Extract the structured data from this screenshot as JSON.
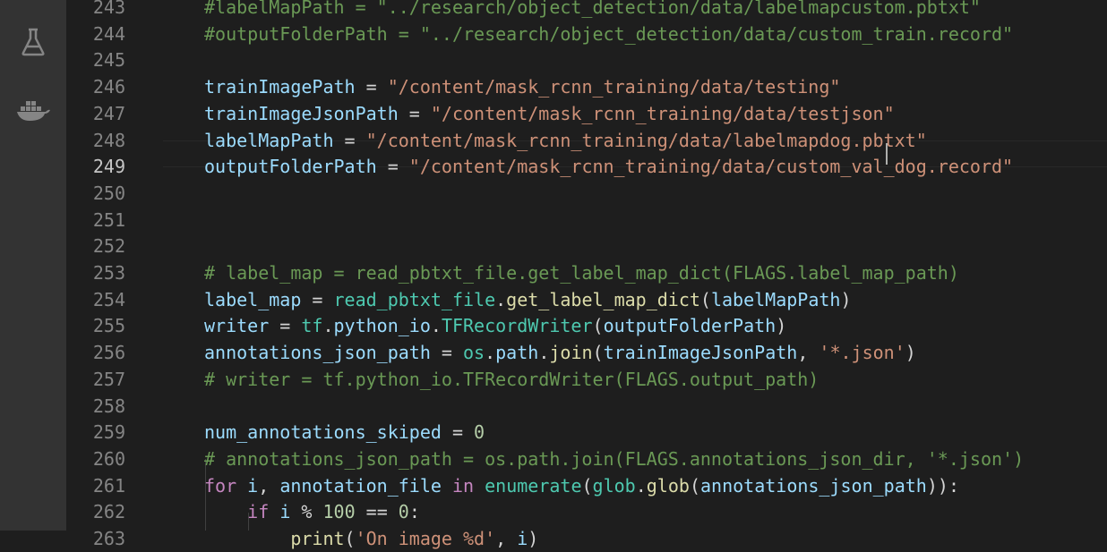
{
  "activity_bar": {
    "icons": [
      "flask-icon",
      "docker-icon"
    ]
  },
  "editor": {
    "current_line": "249",
    "lines": [
      {
        "num": "243",
        "tokens": [
          {
            "c": "c",
            "t": "#labelMapPath = \"../research/object_detection/data/labelmapcustom.pbtxt\""
          }
        ]
      },
      {
        "num": "244",
        "tokens": [
          {
            "c": "c",
            "t": "#outputFolderPath = \"../research/object_detection/data/custom_train.record\""
          }
        ]
      },
      {
        "num": "245",
        "tokens": []
      },
      {
        "num": "246",
        "tokens": [
          {
            "c": "v",
            "t": "trainImagePath"
          },
          {
            "c": "o",
            "t": " = "
          },
          {
            "c": "s",
            "t": "\"/content/mask_rcnn_training/data/testing\""
          }
        ]
      },
      {
        "num": "247",
        "tokens": [
          {
            "c": "v",
            "t": "trainImageJsonPath"
          },
          {
            "c": "o",
            "t": " = "
          },
          {
            "c": "s",
            "t": "\"/content/mask_rcnn_training/data/testjson\""
          }
        ]
      },
      {
        "num": "248",
        "tokens": [
          {
            "c": "v",
            "t": "labelMapPath"
          },
          {
            "c": "o",
            "t": " = "
          },
          {
            "c": "s",
            "t": "\"/content/mask_rcnn_training/data/labelmapdog.pbtxt\""
          }
        ]
      },
      {
        "num": "249",
        "tokens": [
          {
            "c": "v",
            "t": "outputFolderPath"
          },
          {
            "c": "o",
            "t": " = "
          },
          {
            "c": "s",
            "t": "\"/content/mask_rcnn_training/data/custom_val_dog.record\""
          }
        ]
      },
      {
        "num": "250",
        "tokens": []
      },
      {
        "num": "251",
        "tokens": []
      },
      {
        "num": "252",
        "tokens": []
      },
      {
        "num": "253",
        "tokens": [
          {
            "c": "c",
            "t": "# label_map = read_pbtxt_file.get_label_map_dict(FLAGS.label_map_path)"
          }
        ]
      },
      {
        "num": "254",
        "tokens": [
          {
            "c": "v",
            "t": "label_map"
          },
          {
            "c": "o",
            "t": " = "
          },
          {
            "c": "t",
            "t": "read_pbtxt_file"
          },
          {
            "c": "o",
            "t": "."
          },
          {
            "c": "f",
            "t": "get_label_map_dict"
          },
          {
            "c": "o",
            "t": "("
          },
          {
            "c": "v",
            "t": "labelMapPath"
          },
          {
            "c": "o",
            "t": ")"
          }
        ]
      },
      {
        "num": "255",
        "tokens": [
          {
            "c": "v",
            "t": "writer"
          },
          {
            "c": "o",
            "t": " = "
          },
          {
            "c": "t",
            "t": "tf"
          },
          {
            "c": "o",
            "t": "."
          },
          {
            "c": "v",
            "t": "python_io"
          },
          {
            "c": "o",
            "t": "."
          },
          {
            "c": "t",
            "t": "TFRecordWriter"
          },
          {
            "c": "o",
            "t": "("
          },
          {
            "c": "v",
            "t": "outputFolderPath"
          },
          {
            "c": "o",
            "t": ")"
          }
        ]
      },
      {
        "num": "256",
        "tokens": [
          {
            "c": "v",
            "t": "annotations_json_path"
          },
          {
            "c": "o",
            "t": " = "
          },
          {
            "c": "t",
            "t": "os"
          },
          {
            "c": "o",
            "t": "."
          },
          {
            "c": "v",
            "t": "path"
          },
          {
            "c": "o",
            "t": "."
          },
          {
            "c": "f",
            "t": "join"
          },
          {
            "c": "o",
            "t": "("
          },
          {
            "c": "v",
            "t": "trainImageJsonPath"
          },
          {
            "c": "o",
            "t": ", "
          },
          {
            "c": "s",
            "t": "'*.json'"
          },
          {
            "c": "o",
            "t": ")"
          }
        ]
      },
      {
        "num": "257",
        "tokens": [
          {
            "c": "c",
            "t": "# writer = tf.python_io.TFRecordWriter(FLAGS.output_path)"
          }
        ]
      },
      {
        "num": "258",
        "tokens": []
      },
      {
        "num": "259",
        "tokens": [
          {
            "c": "v",
            "t": "num_annotations_skiped"
          },
          {
            "c": "o",
            "t": " = "
          },
          {
            "c": "n",
            "t": "0"
          }
        ]
      },
      {
        "num": "260",
        "tokens": [
          {
            "c": "c",
            "t": "# annotations_json_path = os.path.join(FLAGS.annotations_json_dir, '*.json')"
          }
        ]
      },
      {
        "num": "261",
        "tokens": [
          {
            "c": "k",
            "t": "for"
          },
          {
            "c": "o",
            "t": " "
          },
          {
            "c": "v",
            "t": "i"
          },
          {
            "c": "o",
            "t": ", "
          },
          {
            "c": "v",
            "t": "annotation_file"
          },
          {
            "c": "o",
            "t": " "
          },
          {
            "c": "k",
            "t": "in"
          },
          {
            "c": "o",
            "t": " "
          },
          {
            "c": "t",
            "t": "enumerate"
          },
          {
            "c": "o",
            "t": "("
          },
          {
            "c": "t",
            "t": "glob"
          },
          {
            "c": "o",
            "t": "."
          },
          {
            "c": "f",
            "t": "glob"
          },
          {
            "c": "o",
            "t": "("
          },
          {
            "c": "v",
            "t": "annotations_json_path"
          },
          {
            "c": "o",
            "t": ")):"
          }
        ]
      },
      {
        "num": "262",
        "tokens": [
          {
            "c": "o",
            "t": "    "
          },
          {
            "c": "k",
            "t": "if"
          },
          {
            "c": "o",
            "t": " "
          },
          {
            "c": "v",
            "t": "i"
          },
          {
            "c": "o",
            "t": " % "
          },
          {
            "c": "n",
            "t": "100"
          },
          {
            "c": "o",
            "t": " == "
          },
          {
            "c": "n",
            "t": "0"
          },
          {
            "c": "o",
            "t": ":"
          }
        ]
      },
      {
        "num": "263",
        "tokens": [
          {
            "c": "o",
            "t": "        "
          },
          {
            "c": "f",
            "t": "print"
          },
          {
            "c": "o",
            "t": "("
          },
          {
            "c": "s",
            "t": "'On image %d'"
          },
          {
            "c": "o",
            "t": ", "
          },
          {
            "c": "v",
            "t": "i"
          },
          {
            "c": "o",
            "t": ")"
          }
        ]
      }
    ]
  }
}
